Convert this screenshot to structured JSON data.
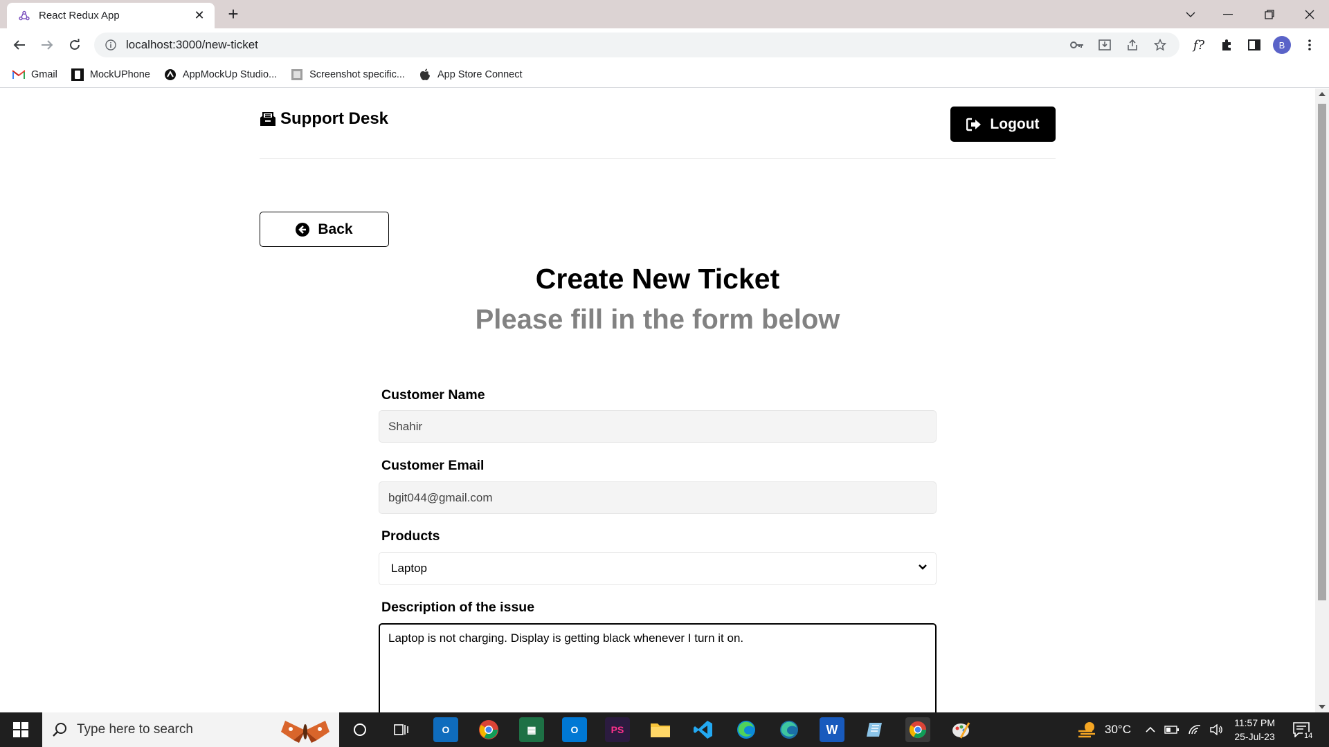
{
  "browser": {
    "tab_title": "React Redux App",
    "url": "localhost:3000/new-ticket",
    "bookmarks": [
      {
        "label": "Gmail",
        "icon": "gmail-icon"
      },
      {
        "label": "MockUPhone",
        "icon": "mockuphone-icon"
      },
      {
        "label": "AppMockUp Studio...",
        "icon": "appmockup-icon"
      },
      {
        "label": "Screenshot specific...",
        "icon": "screenshot-icon"
      },
      {
        "label": "App Store Connect",
        "icon": "apple-icon"
      }
    ],
    "profile_initial": "B"
  },
  "header": {
    "logo_text": "Support Desk",
    "logout_label": "Logout"
  },
  "page": {
    "back_label": "Back",
    "title": "Create New Ticket",
    "subtitle": "Please fill in the form below"
  },
  "form": {
    "name_label": "Customer Name",
    "name_value": "Shahir",
    "email_label": "Customer Email",
    "email_value": "bgit044@gmail.com",
    "product_label": "Products",
    "product_value": "Laptop",
    "description_label": "Description of the issue",
    "description_value": "Laptop is not charging. Display is getting black whenever I turn it on."
  },
  "taskbar": {
    "search_placeholder": "Type here to search",
    "temperature": "30°C",
    "time": "11:57 PM",
    "date": "25-Jul-23",
    "notification_count": "14"
  },
  "colors": {
    "primary": "#000000",
    "subtitle_gray": "#828282",
    "input_bg": "#f4f4f4"
  }
}
